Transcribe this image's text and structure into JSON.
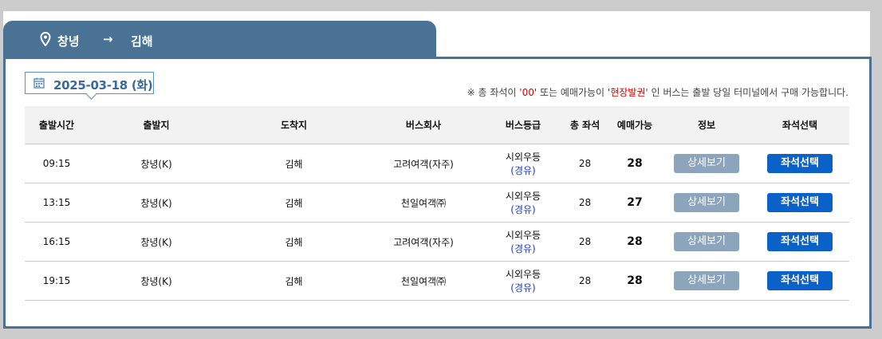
{
  "route": {
    "from": "창녕",
    "to": "김해",
    "arrow": "→"
  },
  "date": "2025-03-18 (화)",
  "notice": {
    "prefix": "※ 총 좌석이 ",
    "zero": "'00'",
    "middle": " 또는 예매가능이 ",
    "onsite": "'현장발권'",
    "suffix": " 인 버스는 출발 당일 터미널에서 구매 가능합니다."
  },
  "columns": [
    "출발시간",
    "출발지",
    "도착지",
    "버스회사",
    "버스등급",
    "총 좌석",
    "예매가능",
    "정보",
    "좌석선택"
  ],
  "buttons": {
    "detail": "상세보기",
    "seat": "좌석선택"
  },
  "rows": [
    {
      "time": "09:15",
      "from": "창녕(K)",
      "to": "김해",
      "company": "고려여객(자주)",
      "grade": "시외우등",
      "grade_sub": "(경유)",
      "total": "28",
      "available": "28"
    },
    {
      "time": "13:15",
      "from": "창녕(K)",
      "to": "김해",
      "company": "천일여객㈜",
      "grade": "시외우등",
      "grade_sub": "(경유)",
      "total": "28",
      "available": "27"
    },
    {
      "time": "16:15",
      "from": "창녕(K)",
      "to": "김해",
      "company": "고려여객(자주)",
      "grade": "시외우등",
      "grade_sub": "(경유)",
      "total": "28",
      "available": "28"
    },
    {
      "time": "19:15",
      "from": "창녕(K)",
      "to": "김해",
      "company": "천일여객㈜",
      "grade": "시외우등",
      "grade_sub": "(경유)",
      "total": "28",
      "available": "28"
    }
  ],
  "colors": {
    "tab": "#4a7295",
    "seat_button": "#0a62c9",
    "detail_button": "#8ca5bd",
    "warning": "#d40000",
    "grade_sub": "#1a3cc9"
  }
}
